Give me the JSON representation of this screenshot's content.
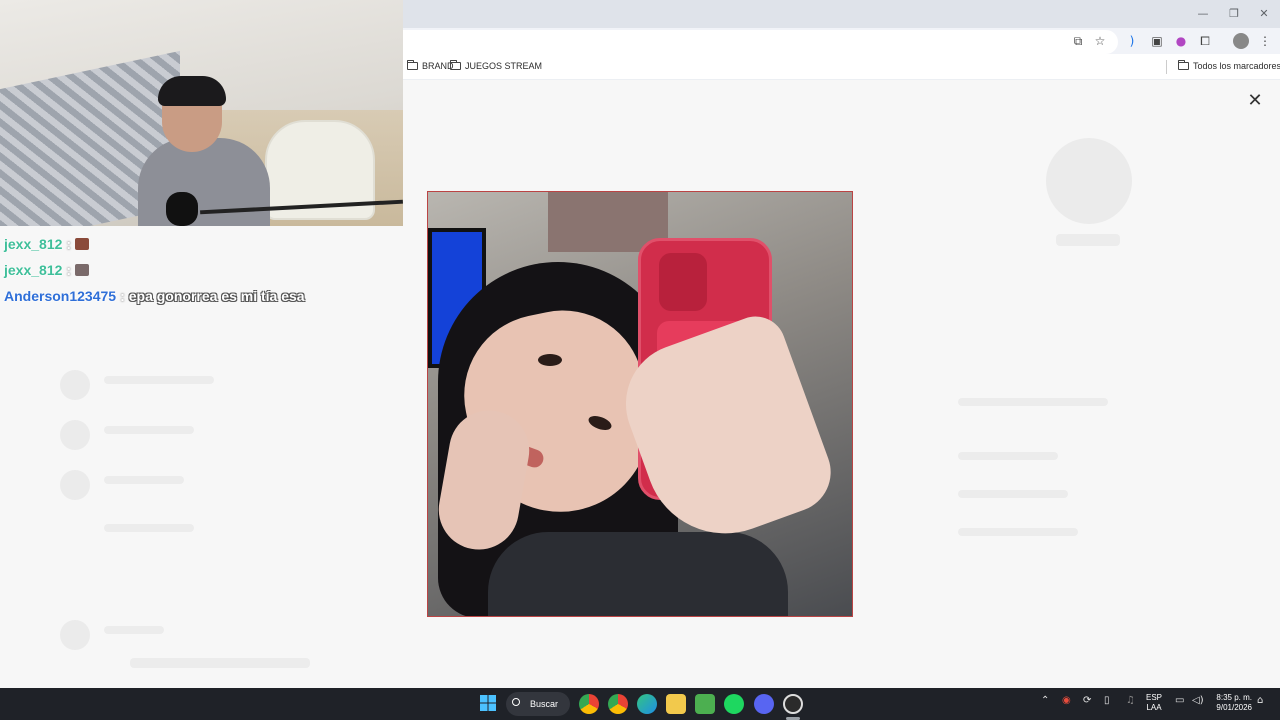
{
  "browser": {
    "bookmarks": [
      "BRAND",
      "JUEGOS STREAM"
    ],
    "all_bookmarks_label": "Todos los marcadores"
  },
  "chat": [
    {
      "user": "jexx_812",
      "color": "#3fbf9a",
      "text": "",
      "emote_color": "#8a4a3a"
    },
    {
      "user": "jexx_812",
      "color": "#3fbf9a",
      "text": "",
      "emote_color": "#7a6a6a"
    },
    {
      "user": "Anderson123475",
      "color": "#2f6fd8",
      "text": "epa gonorrea es mi tía esa",
      "emote_color": ""
    }
  ],
  "viewer": {
    "close_icon": "close-icon"
  },
  "taskbar": {
    "search_label": "Buscar",
    "lang_top": "ESP",
    "lang_bottom": "LAA",
    "time": "8:35 p. m.",
    "date": "9/01/2026"
  }
}
